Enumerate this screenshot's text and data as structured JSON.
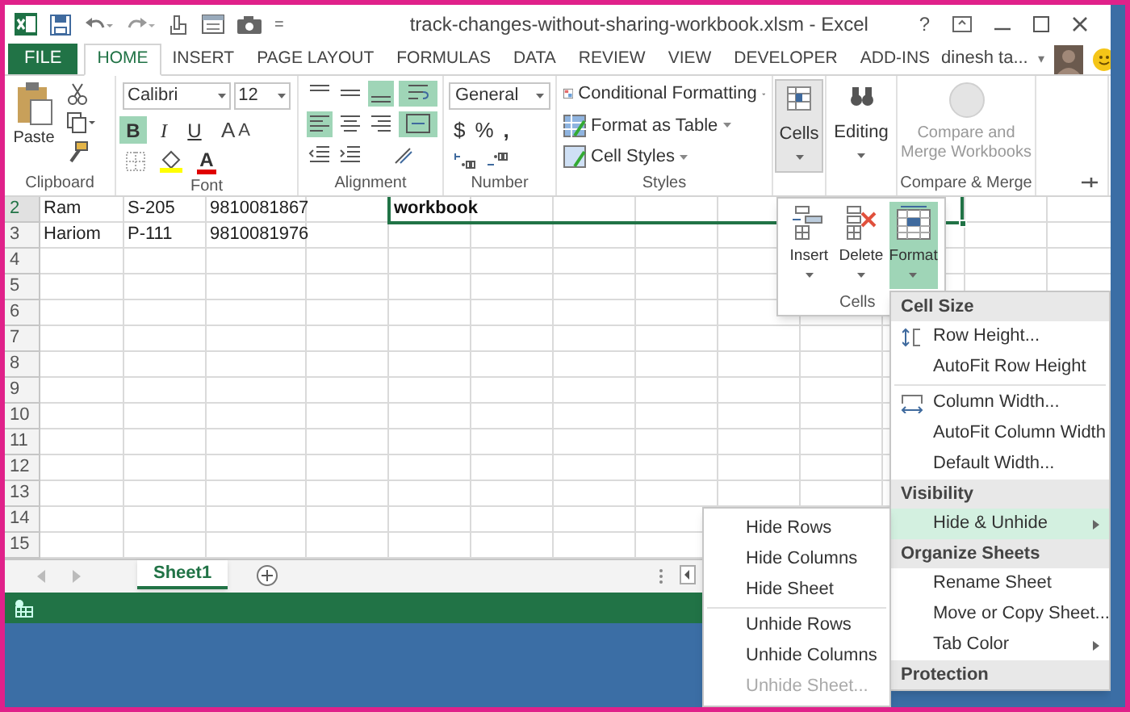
{
  "window": {
    "title": "track-changes-without-sharing-workbook.xlsm - Excel",
    "help": "?",
    "user": "dinesh ta...",
    "user_caret": "▾",
    "qat_caret": "="
  },
  "tabs": [
    {
      "label": "FILE",
      "selected": false,
      "kind": "file"
    },
    {
      "label": "HOME",
      "selected": true,
      "kind": "tab"
    },
    {
      "label": "INSERT",
      "selected": false,
      "kind": "tab"
    },
    {
      "label": "PAGE LAYOUT",
      "selected": false,
      "kind": "tab"
    },
    {
      "label": "FORMULAS",
      "selected": false,
      "kind": "tab"
    },
    {
      "label": "DATA",
      "selected": false,
      "kind": "tab"
    },
    {
      "label": "REVIEW",
      "selected": false,
      "kind": "tab"
    },
    {
      "label": "VIEW",
      "selected": false,
      "kind": "tab"
    },
    {
      "label": "DEVELOPER",
      "selected": false,
      "kind": "tab"
    },
    {
      "label": "ADD-INS",
      "selected": false,
      "kind": "tab"
    }
  ],
  "ribbon": {
    "clipboard": {
      "label": "Clipboard",
      "paste": "Paste"
    },
    "font": {
      "label": "Font",
      "name": "Calibri",
      "size": "12",
      "styles": [
        {
          "text": "B",
          "selected": true
        },
        {
          "text": "I",
          "selected": false
        },
        {
          "text": "U",
          "selected": false
        }
      ],
      "grow": "A",
      "shrink": "A",
      "font_color": "A"
    },
    "alignment": {
      "label": "Alignment",
      "buttons": [
        {
          "selected": false
        },
        {
          "selected": false
        },
        {
          "selected": true
        },
        {
          "selected": true
        },
        {
          "selected": true
        },
        {
          "selected": false
        },
        {
          "selected": false
        },
        {
          "selected": true
        },
        {
          "selected": false
        },
        {
          "selected": false
        },
        {
          "selected": false
        }
      ]
    },
    "number": {
      "label": "Number",
      "format": "General",
      "currency": "$",
      "percent": "%",
      "comma": ","
    },
    "styles": {
      "label": "Styles",
      "items": [
        "Conditional Formatting",
        "Format as Table",
        "Cell Styles"
      ]
    },
    "cells": {
      "label": "Cells",
      "pressed": true
    },
    "editing": {
      "label": "Editing"
    },
    "compare": {
      "label": "Compare and Merge Workbooks",
      "group_label": "Compare & Merge",
      "disabled": true
    }
  },
  "sheet": {
    "rows": [
      {
        "number": "2",
        "selected": true,
        "cells": [
          "Ram",
          "S-205",
          "9810081867"
        ]
      },
      {
        "number": "3",
        "selected": false,
        "cells": [
          "Hariom",
          "P-111",
          "9810081976"
        ]
      },
      {
        "number": "4",
        "selected": false
      },
      {
        "number": "5",
        "selected": false
      },
      {
        "number": "6",
        "selected": false
      },
      {
        "number": "7",
        "selected": false
      },
      {
        "number": "8",
        "selected": false
      },
      {
        "number": "9",
        "selected": false
      },
      {
        "number": "10",
        "selected": false
      },
      {
        "number": "11",
        "selected": false
      },
      {
        "number": "12",
        "selected": false
      },
      {
        "number": "13",
        "selected": false
      },
      {
        "number": "14",
        "selected": false
      },
      {
        "number": "15",
        "selected": false
      }
    ],
    "selection": {
      "text": "workbook"
    },
    "sheet_tabs": [
      {
        "label": "Sheet1",
        "selected": true
      }
    ]
  },
  "cells_popup": {
    "buttons": [
      {
        "label": "Insert",
        "selected": false
      },
      {
        "label": "Delete",
        "selected": false
      },
      {
        "label": "Format",
        "selected": true
      }
    ],
    "label": "Cells"
  },
  "format_menu": {
    "items": [
      {
        "kind": "header",
        "label": "Cell Size"
      },
      {
        "kind": "item",
        "label": "Row Height...",
        "selected": false
      },
      {
        "kind": "item",
        "label": "AutoFit Row Height",
        "selected": false
      },
      {
        "kind": "divider"
      },
      {
        "kind": "item",
        "label": "Column Width...",
        "selected": false
      },
      {
        "kind": "item",
        "label": "AutoFit Column Width",
        "selected": false
      },
      {
        "kind": "item",
        "label": "Default Width...",
        "selected": false
      },
      {
        "kind": "header",
        "label": "Visibility"
      },
      {
        "kind": "item",
        "label": "Hide & Unhide",
        "submenu": true,
        "selected": true
      },
      {
        "kind": "header",
        "label": "Organize Sheets"
      },
      {
        "kind": "item",
        "label": "Rename Sheet",
        "selected": false
      },
      {
        "kind": "item",
        "label": "Move or Copy Sheet...",
        "selected": false
      },
      {
        "kind": "item",
        "label": "Tab Color",
        "submenu": true,
        "selected": false
      },
      {
        "kind": "header",
        "label": "Protection"
      }
    ]
  },
  "submenu": {
    "items": [
      {
        "kind": "item",
        "label": "Hide Rows",
        "disabled": false
      },
      {
        "kind": "item",
        "label": "Hide Columns",
        "disabled": false
      },
      {
        "kind": "item",
        "label": "Hide Sheet",
        "disabled": false
      },
      {
        "kind": "divider"
      },
      {
        "kind": "item",
        "label": "Unhide Rows",
        "disabled": false
      },
      {
        "kind": "item",
        "label": "Unhide Columns",
        "disabled": false
      },
      {
        "kind": "item",
        "label": "Unhide Sheet...",
        "disabled": true
      }
    ]
  }
}
